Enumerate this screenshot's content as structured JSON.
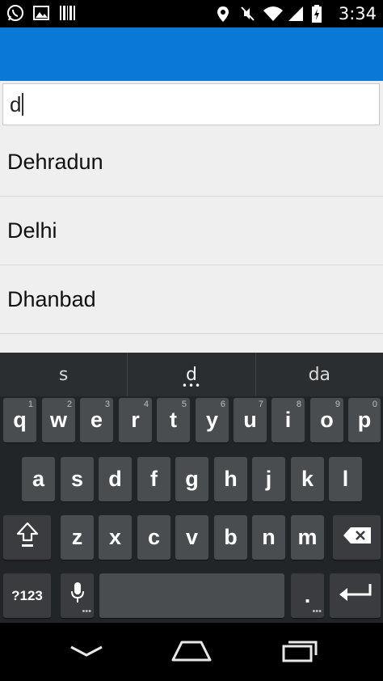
{
  "status_bar": {
    "time": "3:34",
    "left_icons": [
      "whatsapp-icon",
      "image-icon",
      "barcode-icon"
    ],
    "right_icons": [
      "location-icon",
      "mute-icon",
      "wifi-icon",
      "signal-icon",
      "battery-icon"
    ]
  },
  "search": {
    "value": "d"
  },
  "suggestions": [
    "Dehradun",
    "Delhi",
    "Dhanbad"
  ],
  "keyboard": {
    "suggestion_strip": [
      "s",
      "d",
      "da"
    ],
    "row1": [
      {
        "label": "q",
        "hint": "1"
      },
      {
        "label": "w",
        "hint": "2"
      },
      {
        "label": "e",
        "hint": "3"
      },
      {
        "label": "r",
        "hint": "4"
      },
      {
        "label": "t",
        "hint": "5"
      },
      {
        "label": "y",
        "hint": "6"
      },
      {
        "label": "u",
        "hint": "7"
      },
      {
        "label": "i",
        "hint": "8"
      },
      {
        "label": "o",
        "hint": "9"
      },
      {
        "label": "p",
        "hint": "0"
      }
    ],
    "row2": [
      "a",
      "s",
      "d",
      "f",
      "g",
      "h",
      "j",
      "k",
      "l"
    ],
    "row3": [
      "z",
      "x",
      "c",
      "v",
      "b",
      "n",
      "m"
    ],
    "symbols_label": "?123",
    "period_label": "."
  },
  "colors": {
    "action_bar": "#0a78d7",
    "key": "#4a4d50",
    "keyboard_bg": "#222528"
  }
}
